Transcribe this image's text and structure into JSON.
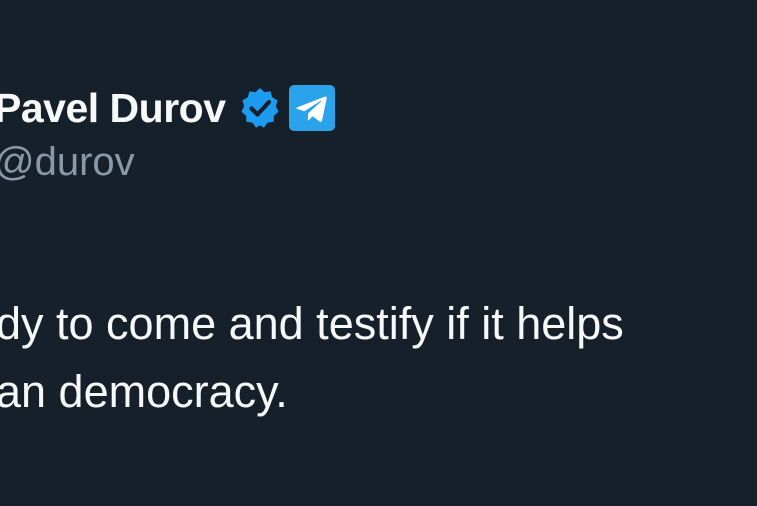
{
  "author": {
    "display_name": "Pavel Durov",
    "handle": "@durov",
    "verified_icon": "verified-badge-icon",
    "affiliate_icon": "telegram-logo-icon",
    "verified_color": "#1d9bf0",
    "affiliate_color": "#2aa3ea"
  },
  "tweet": {
    "lines": [
      "dy to come and testify if it helps",
      "an democracy."
    ]
  },
  "colors": {
    "background": "#15202b",
    "text": "#f7f9f9",
    "secondary_text": "#8b98a5"
  }
}
